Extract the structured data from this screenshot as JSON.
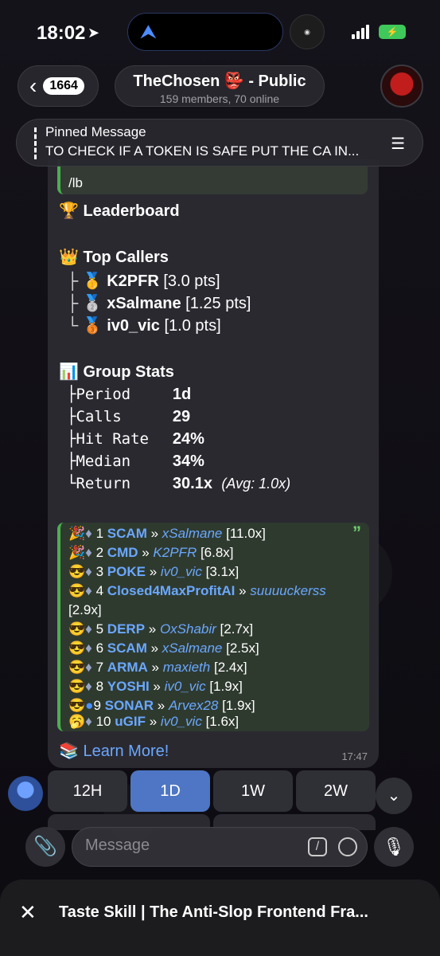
{
  "status_bar": {
    "time": "18:02",
    "battery": "⚡"
  },
  "header": {
    "back_count": "1664",
    "title": "TheChosen 👺 - Public",
    "subtitle": "159 members, 70 online"
  },
  "pinned": {
    "label": "Pinned Message",
    "text": "TO CHECK IF A TOKEN IS SAFE PUT THE CA IN..."
  },
  "message": {
    "command": "/lb",
    "leaderboard_title": "🏆 Leaderboard",
    "top_callers_title": "👑 Top Callers",
    "top_callers": [
      {
        "tree": "├",
        "medal": "🥇",
        "name": "K2PFR",
        "pts": "[3.0 pts]"
      },
      {
        "tree": "├",
        "medal": "🥈",
        "name": "xSalmane",
        "pts": "[1.25 pts]"
      },
      {
        "tree": "└",
        "medal": "🥉",
        "name": "iv0_vic",
        "pts": "[1.0 pts]"
      }
    ],
    "group_stats_title": "📊 Group Stats",
    "stats": [
      {
        "tree": "├",
        "label": "Period",
        "value": "1d",
        "extra": ""
      },
      {
        "tree": "├",
        "label": "Calls",
        "value": "29",
        "extra": ""
      },
      {
        "tree": "├",
        "label": "Hit Rate",
        "value": "24%",
        "extra": ""
      },
      {
        "tree": "├",
        "label": "Median",
        "value": "34%",
        "extra": ""
      },
      {
        "tree": "└",
        "label": "Return",
        "value": "30.1x",
        "extra": "(Avg: 1.0x)"
      }
    ],
    "ranks": [
      {
        "emoji": "🎉",
        "chain": "♦",
        "n": "1",
        "token": "SCAM",
        "user": "xSalmane",
        "mult": "[11.0x]"
      },
      {
        "emoji": "🎉",
        "chain": "♦",
        "n": "2",
        "token": "CMD",
        "user": "K2PFR",
        "mult": "[6.8x]"
      },
      {
        "emoji": "😎",
        "chain": "♦",
        "n": "3",
        "token": "POKE",
        "user": "iv0_vic",
        "mult": "[3.1x]"
      },
      {
        "emoji": "😎",
        "chain": "♦",
        "n": "4",
        "token": "Closed4MaxProfitAI",
        "user": "suuuuckerss",
        "mult": "[2.9x]"
      },
      {
        "emoji": "😎",
        "chain": "♦",
        "n": "5",
        "token": "DERP",
        "user": "OxShabir",
        "mult": "[2.7x]"
      },
      {
        "emoji": "😎",
        "chain": "♦",
        "n": "6",
        "token": "SCAM",
        "user": "xSalmane",
        "mult": "[2.5x]"
      },
      {
        "emoji": "😎",
        "chain": "♦",
        "n": "7",
        "token": "ARMA",
        "user": "maxieth",
        "mult": "[2.4x]"
      },
      {
        "emoji": "😎",
        "chain": "♦",
        "n": "8",
        "token": "YOSHI",
        "user": "iv0_vic",
        "mult": "[1.9x]"
      },
      {
        "emoji": "😎",
        "chain": "●",
        "n": "9",
        "token": "SONAR",
        "user": "Arvex28",
        "mult": "[1.9x]"
      },
      {
        "emoji": "🥱",
        "chain": "♦",
        "n": "10",
        "token": "uGIF",
        "user": "iv0_vic",
        "mult": "[1.6x]"
      }
    ],
    "learn_more": "📚 Learn More!",
    "time": "17:47"
  },
  "keyboard": {
    "buttons": [
      "12H",
      "1D",
      "1W",
      "2W"
    ],
    "active": "1D"
  },
  "input": {
    "placeholder": "Message"
  },
  "browser": {
    "title": "Taste Skill | The Anti-Slop Frontend Fra..."
  }
}
